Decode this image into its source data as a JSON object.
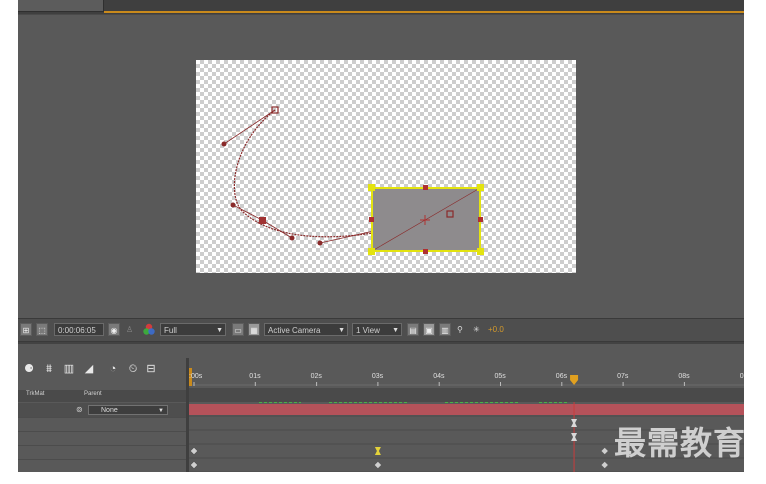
{
  "viewer": {
    "timecode": "0:00:06:05",
    "resolution": "Full",
    "camera": "Active Camera",
    "view_layout": "1 View",
    "exposure_offset": "+0.0"
  },
  "timeline": {
    "toolbar_icons": [
      "comp-mini-flowchart-icon",
      "shy-layers-icon",
      "frame-blending-icon",
      "motion-blur-icon",
      "brainstorm-icon",
      "graph-editor-icon",
      "draft-3d-icon"
    ],
    "columns": {
      "trkmat": "TrkMat",
      "parent": "Parent"
    },
    "layer": {
      "parent": "None"
    },
    "ruler_labels": [
      ":00s",
      "01s",
      "02s",
      "03s",
      "04s",
      "05s",
      "06s",
      "07s",
      "08s",
      "0"
    ],
    "current_time_seconds": 6.2
  },
  "watermark": "最需教育",
  "colors": {
    "accent_orange": "#c98a1c",
    "layer_bar": "#b5525a",
    "selection_yellow": "#e3e310",
    "motion_path": "#8a2a2a",
    "playhead": "#e0a020"
  }
}
